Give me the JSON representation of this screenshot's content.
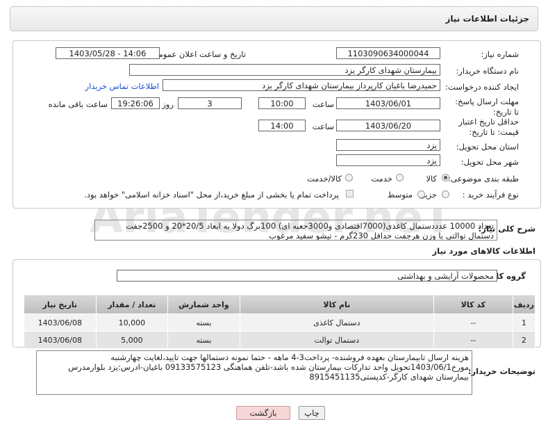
{
  "page_title": "جزئیات اطلاعات نیاز",
  "form": {
    "need_number_label": "شماره نیاز:",
    "need_number": "1103090634000044",
    "announce_label": "تاریخ و ساعت اعلان عمومی:",
    "announce_value": "1403/05/28 - 14:06",
    "buyer_label": "نام دستگاه خریدار:",
    "buyer_value": "بیمارستان شهدای کارگر یزد",
    "creator_label": "ایجاد کننده درخواست:",
    "creator_value": "حمیدرضا باغیان کارپرداز بیمارستان شهدای کارگر یزد",
    "contact_link": "اطلاعات تماس خریدار",
    "deadline_label": "مهلت ارسال پاسخ: تا تاریخ:",
    "deadline_date": "1403/06/01",
    "time_label": "ساعت",
    "deadline_time": "10:00",
    "days_value": "3",
    "days_label": "روز و",
    "remaining_time": "19:26:06",
    "remaining_label": "ساعت باقی مانده",
    "price_validity_label": "حداقل تاریخ اعتبار قیمت: تا تاریخ:",
    "price_validity_date": "1403/06/20",
    "price_validity_time_label": "ساعت",
    "price_validity_time": "14:00",
    "province_label": "استان محل تحویل:",
    "province_value": "یزد",
    "city_label": "شهر محل تحویل:",
    "city_value": "یزد",
    "category_label": "طبقه بندی موضوعی:",
    "category_options": [
      "کالا",
      "خدمت",
      "کالا/خدمت"
    ],
    "category_selected": "کالا",
    "process_label": "نوع فرآیند خرید :",
    "process_options": [
      "جزیی",
      "متوسط"
    ],
    "process_note": "پرداخت تمام یا بخشی از مبلغ خرید،از محل \"اسناد خزانه اسلامی\" خواهد بود."
  },
  "description": {
    "label": "شرح کلی نیاز:",
    "text": "تعداد 10000 عدددستمال کاغذی(7000اقتصادی و3000جعبه ای) 100برگ دولا به ابعاد 20/5*20 و 2500جفت دستمال توالتی با وزن هرجفت حداقل 230گرم - تیشو سفید مرغوب"
  },
  "goods": {
    "section_title": "اطلاعات کالاهای مورد نیاز",
    "group_label": "گروه کالا:",
    "group_value": "محصولات آرایشی و بهداشتی",
    "columns": [
      "ردیف",
      "کد کالا",
      "نام کالا",
      "واحد شمارش",
      "تعداد / مقدار",
      "تاریخ نیاز"
    ],
    "rows": [
      [
        "1",
        "--",
        "دستمال کاغذی",
        "بسته",
        "10,000",
        "1403/06/08"
      ],
      [
        "2",
        "--",
        "دستمال توالت",
        "بسته",
        "5,000",
        "1403/06/08"
      ]
    ]
  },
  "buyer_notes": {
    "label": "توضیحات خریدار:",
    "text": "هزینه ارسال تابیمارستان بعهده فروشنده- پرداخت3-4 ماهه - حتما نمونه دستمالها جهت تایید،لغایت چهارشنبه مورخ1403/06/1تحویل واحد تدارکات بیمارستان شده باشد-تلفن هماهنگی 09133575123 باغیان-ادرس:یزد بلوارمدرس بیمارستان شهدای کارگر-کدپستی8915451135"
  },
  "buttons": {
    "print": "چاپ",
    "back": "بازگشت"
  },
  "watermark": "AriaTender.neT",
  "colors": {
    "link": "#1a4fd6",
    "back_button": "#f6d6d6",
    "table_header": "#c8c8c8"
  }
}
